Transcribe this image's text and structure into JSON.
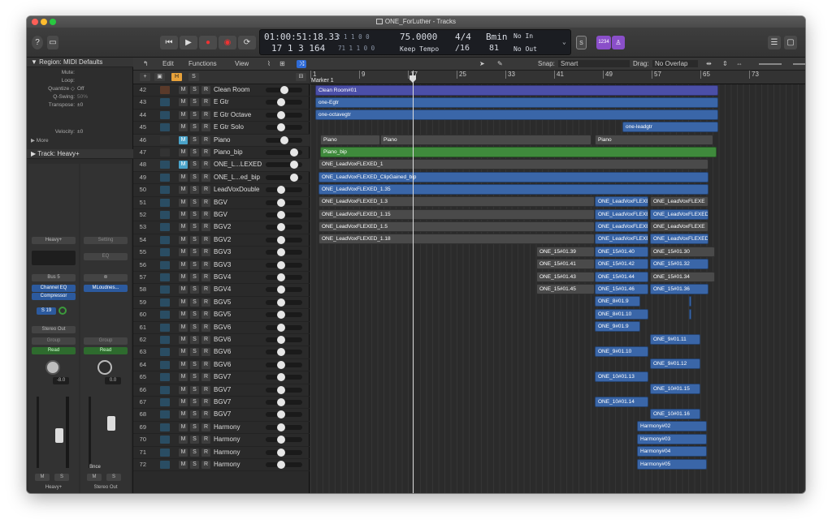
{
  "window": {
    "title": "ONE_ForLuther - Tracks"
  },
  "lcd": {
    "position_time": "01:00:51:18.33",
    "position_time_sub": "2 1 1 0 0",
    "position_bars": "17 1 3 164",
    "position_bars_sub": "71 1 1 0 0",
    "tempo": "75.0000",
    "tempo_mode": "Keep Tempo",
    "signature": "4/4",
    "division": "/16",
    "key": "Bmin",
    "key_sub": "81",
    "in": "No In",
    "out": "No Out"
  },
  "transport": {
    "counter": "1234"
  },
  "inspector": {
    "region_header": "▼ Region: MIDI Defaults",
    "rows": [
      {
        "label": "Mute:",
        "value": ""
      },
      {
        "label": "Loop:",
        "value": ""
      },
      {
        "label": "Quantize ◇",
        "value": "Off"
      },
      {
        "label": "Q-Swing:",
        "value": "50%"
      },
      {
        "label": "Transpose:",
        "value": "±0"
      },
      {
        "label": "Velocity:",
        "value": "±0"
      }
    ],
    "more": "▶ More",
    "track_header": "▶ Track:  Heavy+",
    "strip1": {
      "setting": "Heavy+",
      "bus": "Bus 5",
      "plugin1": "Channel EQ",
      "plugin2": "Compressor",
      "send": "S 19",
      "output": "Stereo Out",
      "group": "Group",
      "auto": "Read",
      "vol": "-8.0",
      "name": "Heavy+"
    },
    "strip2": {
      "setting": "Setting",
      "eq": "EQ",
      "plugin1": "MLoudnes...",
      "group": "Group",
      "auto": "Read",
      "vol": "0.0",
      "bnce": "Bnce",
      "name": "Stereo Out"
    }
  },
  "toolbar": {
    "edit": "Edit",
    "functions": "Functions",
    "view": "View",
    "snap_label": "Snap:",
    "snap_value": "Smart",
    "drag_label": "Drag:",
    "drag_value": "No Overlap"
  },
  "trackhdr": {
    "h": "H",
    "s": "S"
  },
  "tracks": [
    {
      "num": "42",
      "name": "Clean Room"
    },
    {
      "num": "43",
      "name": "E Gtr"
    },
    {
      "num": "44",
      "name": "E Gtr Octave"
    },
    {
      "num": "45",
      "name": "E Gtr Solo"
    },
    {
      "num": "46",
      "name": "Piano"
    },
    {
      "num": "47",
      "name": "Piano_bip"
    },
    {
      "num": "48",
      "name": "ONE_L...LEXED"
    },
    {
      "num": "49",
      "name": "ONE_L...ed_bip"
    },
    {
      "num": "50",
      "name": "LeadVoxDouble"
    },
    {
      "num": "51",
      "name": "BGV"
    },
    {
      "num": "52",
      "name": "BGV"
    },
    {
      "num": "53",
      "name": "BGV2"
    },
    {
      "num": "54",
      "name": "BGV2"
    },
    {
      "num": "55",
      "name": "BGV3"
    },
    {
      "num": "56",
      "name": "BGV3"
    },
    {
      "num": "57",
      "name": "BGV4"
    },
    {
      "num": "58",
      "name": "BGV4"
    },
    {
      "num": "59",
      "name": "BGV5"
    },
    {
      "num": "60",
      "name": "BGV5"
    },
    {
      "num": "61",
      "name": "BGV6"
    },
    {
      "num": "62",
      "name": "BGV6"
    },
    {
      "num": "63",
      "name": "BGV6"
    },
    {
      "num": "64",
      "name": "BGV6"
    },
    {
      "num": "65",
      "name": "BGV7"
    },
    {
      "num": "66",
      "name": "BGV7"
    },
    {
      "num": "67",
      "name": "BGV7"
    },
    {
      "num": "68",
      "name": "BGV7"
    },
    {
      "num": "69",
      "name": "Harmony"
    },
    {
      "num": "70",
      "name": "Harmony"
    },
    {
      "num": "71",
      "name": "Harmony"
    },
    {
      "num": "72",
      "name": "Harmony"
    }
  ],
  "track_buttons": {
    "m": "M",
    "s": "S",
    "r": "R"
  },
  "ruler": {
    "marker": "Marker 1",
    "bars": [
      "1",
      "9",
      "17",
      "25",
      "33",
      "41",
      "49",
      "57",
      "65",
      "73"
    ]
  },
  "regions": {
    "r0": "Clean Room#01",
    "r1": "one-Egtr",
    "r2": "one-octavegtr",
    "r3": "one-leadgtr",
    "r4": "Piano",
    "r5": "Piano",
    "r6": "Piano",
    "r7": "Piano_bip",
    "r8": "ONE_LeadVoxFLEXED_1",
    "r9": "ONE_LeadVoxFLEXED_ClipGained_bip",
    "r10": "ONE_LeadVoxFLEXED_1.35",
    "r11": "ONE_LeadVoxFLEXED_1.3",
    "r12": "ONE_LeadVoxFLEXE",
    "r13": "ONE_LeadVoxFLEXE",
    "r14": "ONE_LeadVoxFLEXED_1.15",
    "r15": "ONE_LeadVoxFLEXE",
    "r16": "ONE_LeadVoxFLEXED_1",
    "r17": "ONE_LeadVoxFLEXED_1.5",
    "r18": "ONE_LeadVoxFLEXE",
    "r19": "ONE_LeadVoxFLEXE",
    "r20": "ONE_LeadVoxFLEXED_1.18",
    "r21": "ONE_LeadVoxFLEXE",
    "r22": "ONE_LeadVoxFLEXED_1",
    "r23": "ONE_15#01.39",
    "r24": "ONE_15#01.40",
    "r25": "ONE_15#01.30",
    "r26": "ONE_15#01.41",
    "r27": "ONE_15#01.42",
    "r28": "ONE_15#01.32",
    "r29": "ONE_15#01.43",
    "r30": "ONE_15#01.44",
    "r31": "ONE_15#01.34",
    "r32": "ONE_15#01.45",
    "r33": "ONE_15#01.46",
    "r34": "ONE_15#01.36",
    "r35": "ONE_8#01.9",
    "r36": "ONE_8#01.10",
    "r37": "ONE_9#01.9",
    "r38": "ONE_9#01.11",
    "r39": "ONE_9#01.10",
    "r40": "ONE_9#01.12",
    "r41": "ONE_10#01.13",
    "r42": "ONE_10#01.15",
    "r43": "ONE_10#01.14",
    "r44": "ONE_10#01.16",
    "r45": "Harmony#02",
    "r46": "Harmony#03",
    "r47": "Harmony#04",
    "r48": "Harmony#05"
  }
}
